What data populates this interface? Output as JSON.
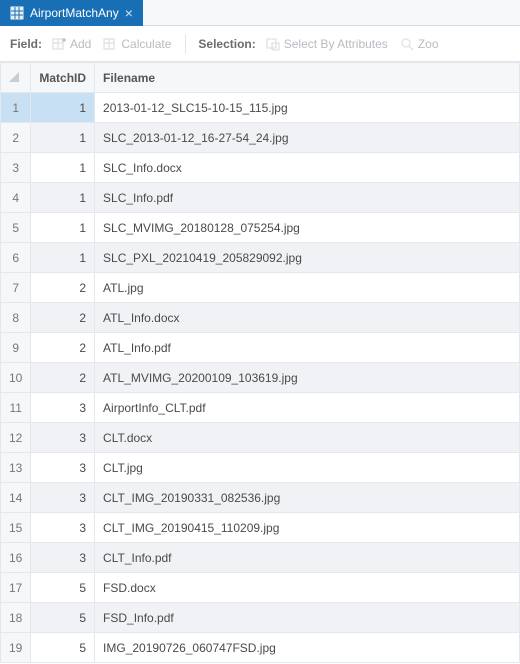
{
  "tab": {
    "title": "AirportMatchAny"
  },
  "toolbar": {
    "field_label": "Field:",
    "add_label": "Add",
    "calculate_label": "Calculate",
    "selection_label": "Selection:",
    "select_by_attr_label": "Select By Attributes",
    "zoom_label": "Zoo"
  },
  "columns": {
    "matchid": "MatchID",
    "filename": "Filename"
  },
  "rows": [
    {
      "n": "1",
      "matchid": "1",
      "filename": "2013-01-12_SLC15-10-15_115.jpg",
      "selected": true
    },
    {
      "n": "2",
      "matchid": "1",
      "filename": "SLC_2013-01-12_16-27-54_24.jpg"
    },
    {
      "n": "3",
      "matchid": "1",
      "filename": "SLC_Info.docx"
    },
    {
      "n": "4",
      "matchid": "1",
      "filename": "SLC_Info.pdf"
    },
    {
      "n": "5",
      "matchid": "1",
      "filename": "SLC_MVIMG_20180128_075254.jpg"
    },
    {
      "n": "6",
      "matchid": "1",
      "filename": "SLC_PXL_20210419_205829092.jpg"
    },
    {
      "n": "7",
      "matchid": "2",
      "filename": "ATL.jpg"
    },
    {
      "n": "8",
      "matchid": "2",
      "filename": "ATL_Info.docx"
    },
    {
      "n": "9",
      "matchid": "2",
      "filename": "ATL_Info.pdf"
    },
    {
      "n": "10",
      "matchid": "2",
      "filename": "ATL_MVIMG_20200109_103619.jpg"
    },
    {
      "n": "11",
      "matchid": "3",
      "filename": "AirportInfo_CLT.pdf"
    },
    {
      "n": "12",
      "matchid": "3",
      "filename": "CLT.docx"
    },
    {
      "n": "13",
      "matchid": "3",
      "filename": "CLT.jpg"
    },
    {
      "n": "14",
      "matchid": "3",
      "filename": "CLT_IMG_20190331_082536.jpg"
    },
    {
      "n": "15",
      "matchid": "3",
      "filename": "CLT_IMG_20190415_110209.jpg"
    },
    {
      "n": "16",
      "matchid": "3",
      "filename": "CLT_Info.pdf"
    },
    {
      "n": "17",
      "matchid": "5",
      "filename": "FSD.docx"
    },
    {
      "n": "18",
      "matchid": "5",
      "filename": "FSD_Info.pdf"
    },
    {
      "n": "19",
      "matchid": "5",
      "filename": "IMG_20190726_060747FSD.jpg"
    }
  ]
}
